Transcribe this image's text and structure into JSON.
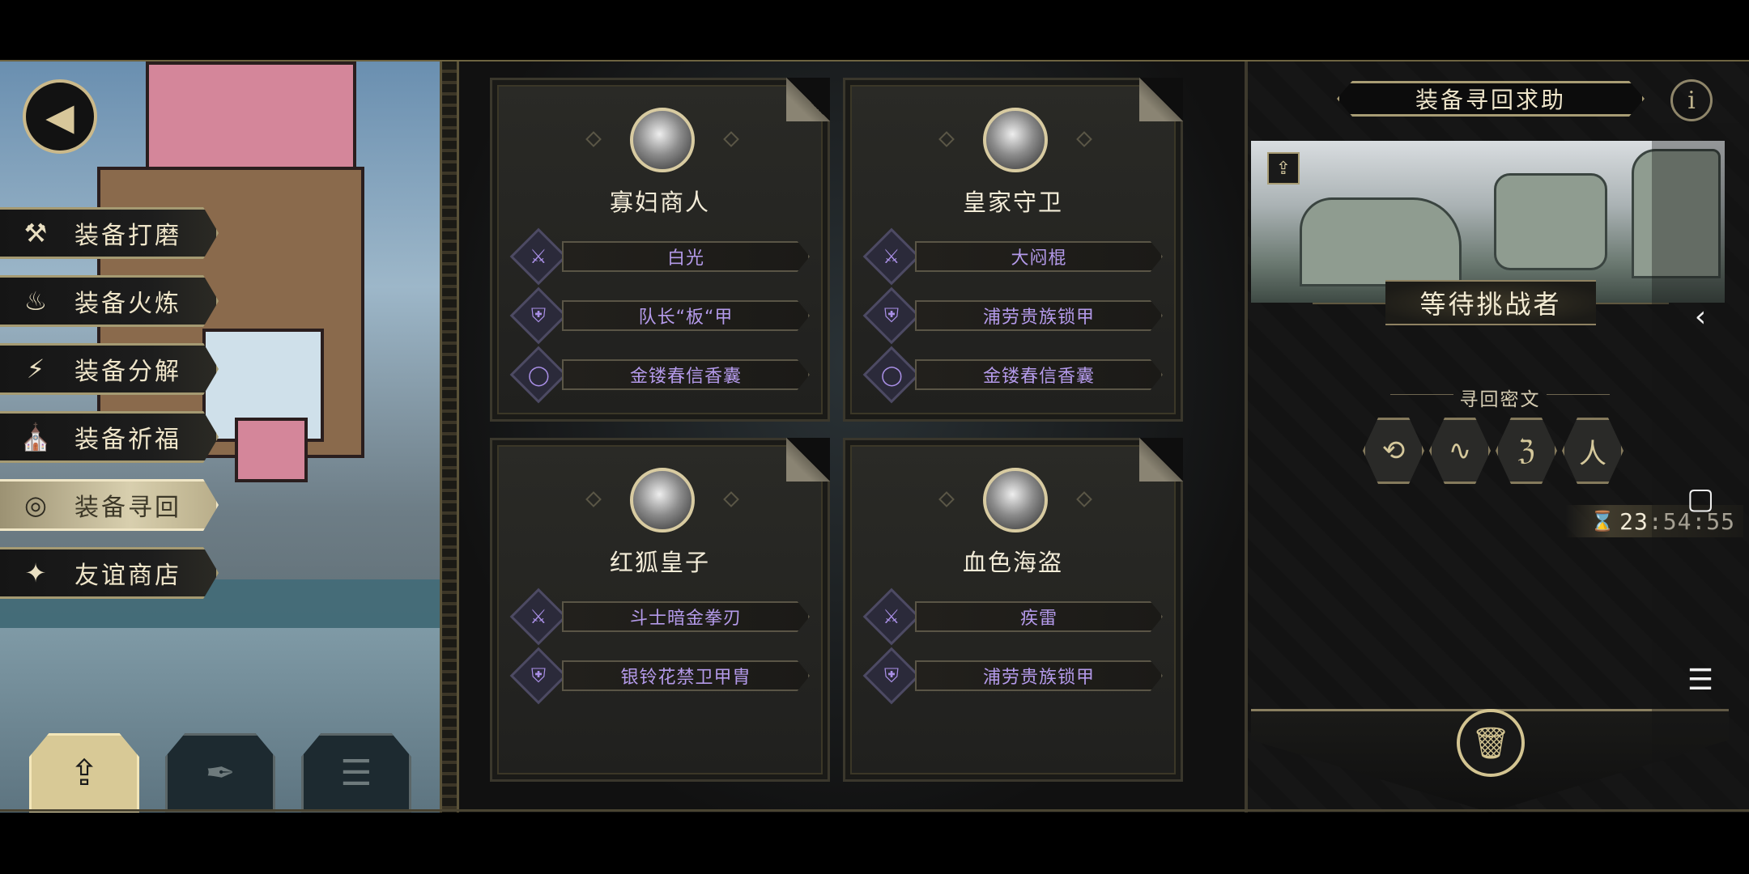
{
  "menu": [
    {
      "label": "装备打磨",
      "icon": "hammer-icon",
      "glyph": "⚒",
      "active": false
    },
    {
      "label": "装备火炼",
      "icon": "flame-icon",
      "glyph": "♨",
      "active": false
    },
    {
      "label": "装备分解",
      "icon": "disassemble-icon",
      "glyph": "⚡",
      "active": false
    },
    {
      "label": "装备祈福",
      "icon": "pray-icon",
      "glyph": "⛪",
      "active": false
    },
    {
      "label": "装备寻回",
      "icon": "target-icon",
      "glyph": "◎",
      "active": true
    },
    {
      "label": "友谊商店",
      "icon": "fox-icon",
      "glyph": "✦",
      "active": false
    }
  ],
  "bottom_tabs": [
    {
      "icon": "upload-icon",
      "glyph": "⇪",
      "active": true
    },
    {
      "icon": "feather-icon",
      "glyph": "✒",
      "active": false
    },
    {
      "icon": "list-icon",
      "glyph": "☰",
      "active": false
    }
  ],
  "cards": [
    {
      "name": "寡妇商人",
      "items": [
        {
          "type": "weapon",
          "glyph": "⚔",
          "label": "白光"
        },
        {
          "type": "armor",
          "glyph": "⛨",
          "label": "队长“板“甲"
        },
        {
          "type": "ring",
          "glyph": "◯",
          "label": "金镂春信香囊"
        }
      ]
    },
    {
      "name": "皇家守卫",
      "items": [
        {
          "type": "weapon",
          "glyph": "⚔",
          "label": "大闷棍"
        },
        {
          "type": "armor",
          "glyph": "⛨",
          "label": "浦劳贵族锁甲"
        },
        {
          "type": "ring",
          "glyph": "◯",
          "label": "金镂春信香囊"
        }
      ]
    },
    {
      "name": "红狐皇子",
      "items": [
        {
          "type": "weapon",
          "glyph": "⚔",
          "label": "斗士暗金拳刃"
        },
        {
          "type": "armor",
          "glyph": "⛨",
          "label": "银铃花禁卫甲胄"
        }
      ]
    },
    {
      "name": "血色海盗",
      "items": [
        {
          "type": "weapon",
          "glyph": "⚔",
          "label": "疾雷"
        },
        {
          "type": "armor",
          "glyph": "⛨",
          "label": "浦劳贵族锁甲"
        }
      ]
    }
  ],
  "right_panel": {
    "title": "装备寻回求助",
    "info_glyph": "i",
    "status": "等待挑战者",
    "code_label": "寻回密文",
    "runes": [
      "⟲",
      "∿",
      "ℨ",
      "人"
    ],
    "timer": "23:54:55"
  },
  "system_nav": {
    "back": "‹",
    "home": "▢",
    "menu": "☰"
  }
}
